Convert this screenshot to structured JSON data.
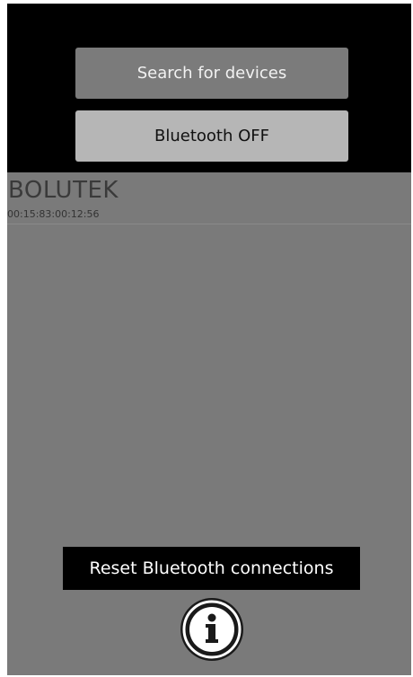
{
  "buttons": {
    "search_label": "Search for devices",
    "bluetooth_label": "Bluetooth OFF",
    "reset_label": "Reset Bluetooth connections"
  },
  "devices": [
    {
      "name": "BOLUTEK",
      "address": "00:15:83:00:12:56"
    }
  ],
  "icons": {
    "info": "info-icon"
  },
  "colors": {
    "top_background": "#000000",
    "list_background": "#7a7a7a",
    "search_button": "#7b7b7b",
    "bluetooth_button": "#b6b6b6",
    "reset_button": "#000000"
  }
}
